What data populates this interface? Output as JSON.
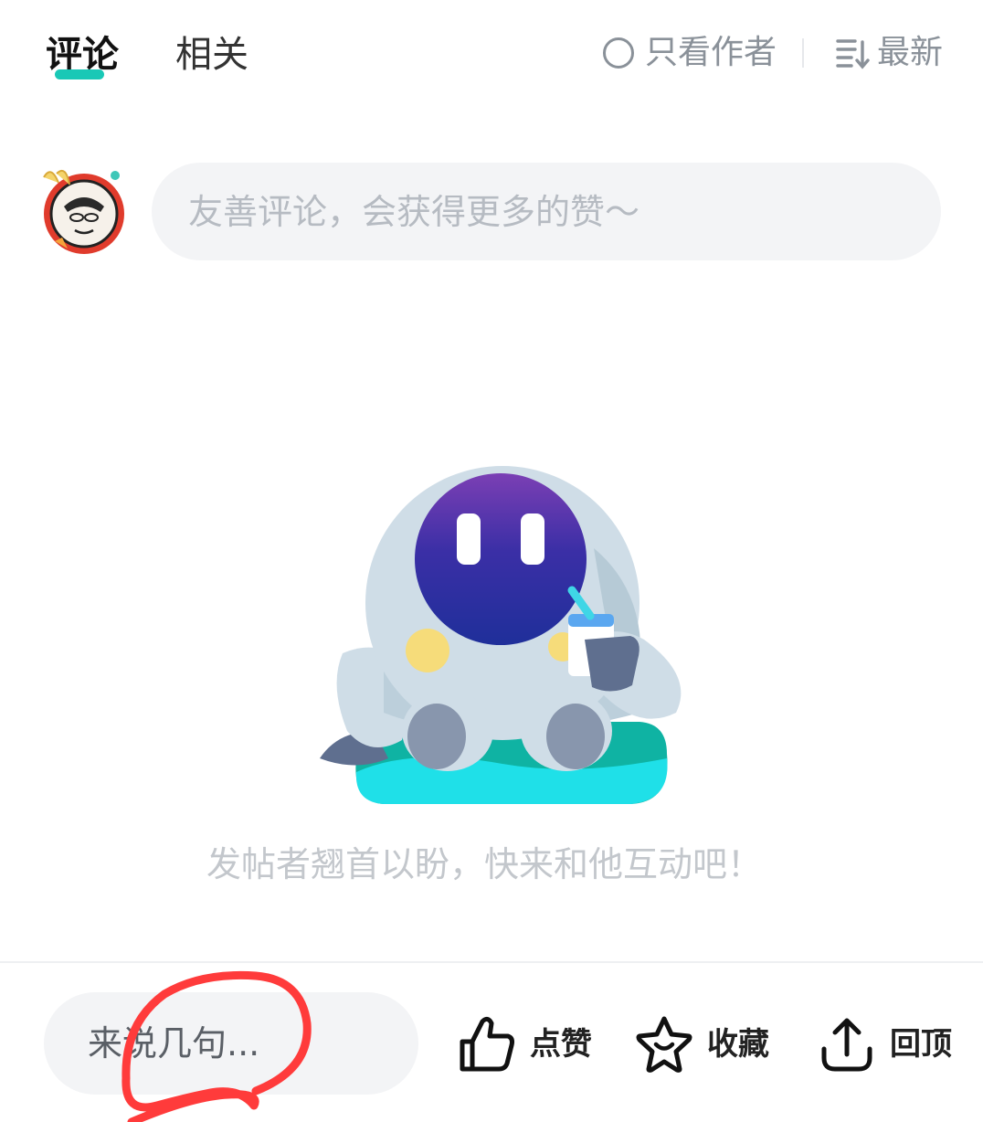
{
  "tabs": {
    "comments_label": "评论",
    "related_label": "相关",
    "active_color": "#19c8b6"
  },
  "filters": {
    "author_only_label": "只看作者",
    "sort_label": "最新"
  },
  "comment_box": {
    "placeholder": "友善评论，会获得更多的赞～"
  },
  "empty_state": {
    "message": "发帖者翘首以盼，快来和他互动吧！",
    "illustration": "robot-mascot-drinking"
  },
  "bottom_bar": {
    "reply_placeholder": "来说几句...",
    "like_label": "点赞",
    "favorite_label": "收藏",
    "back_to_top_label": "回顶"
  },
  "icons": {
    "author_only": "radio-circle-icon",
    "sort": "sort-desc-icon",
    "like": "thumbs-up-icon",
    "favorite": "star-icon",
    "back_to_top": "arrow-up-icon"
  },
  "colors": {
    "accent": "#19c8b6",
    "muted_text": "#8a9199",
    "input_bg": "#f3f4f6",
    "annotation_red": "#ff3b3b"
  }
}
